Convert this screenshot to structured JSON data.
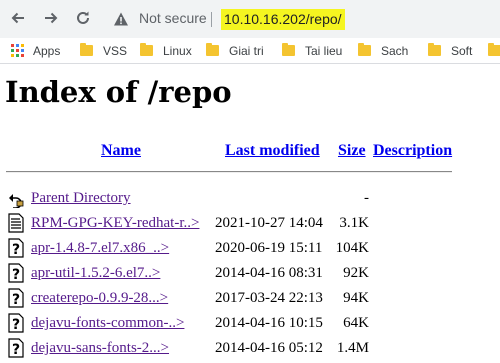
{
  "browser": {
    "back_icon": "arrow-left-icon",
    "forward_icon": "arrow-right-icon",
    "reload_icon": "reload-icon",
    "security_label": "Not secure",
    "url": "10.10.16.202/repo/",
    "url_highlight_color": "#f5f520"
  },
  "bookmarks": {
    "apps_label": "Apps",
    "items": [
      {
        "label": "VSS"
      },
      {
        "label": "Linux"
      },
      {
        "label": "Giai tri"
      },
      {
        "label": "Tai lieu"
      },
      {
        "label": "Sach"
      },
      {
        "label": "Soft"
      }
    ]
  },
  "page": {
    "title": "Index of /repo",
    "columns": {
      "name": "Name",
      "last_modified": "Last modified",
      "size": "Size",
      "description": "Description"
    },
    "entries": [
      {
        "icon": "parent-directory-icon",
        "name": "Parent Directory",
        "modified": "",
        "size": "-"
      },
      {
        "icon": "text-file-icon",
        "name": "RPM-GPG-KEY-redhat-r..>",
        "modified": "2021-10-27 14:04",
        "size": "3.1K"
      },
      {
        "icon": "unknown-file-icon",
        "name": "apr-1.4.8-7.el7.x86_..>",
        "modified": "2020-06-19 15:11",
        "size": "104K"
      },
      {
        "icon": "unknown-file-icon",
        "name": "apr-util-1.5.2-6.el7..>",
        "modified": "2014-04-16 08:31",
        "size": "92K"
      },
      {
        "icon": "unknown-file-icon",
        "name": "createrepo-0.9.9-28...>",
        "modified": "2017-03-24 22:13",
        "size": "94K"
      },
      {
        "icon": "unknown-file-icon",
        "name": "dejavu-fonts-common-..>",
        "modified": "2014-04-16 10:15",
        "size": "64K"
      },
      {
        "icon": "unknown-file-icon",
        "name": "dejavu-sans-fonts-2...>",
        "modified": "2014-04-16 05:12",
        "size": "1.4M"
      }
    ]
  }
}
